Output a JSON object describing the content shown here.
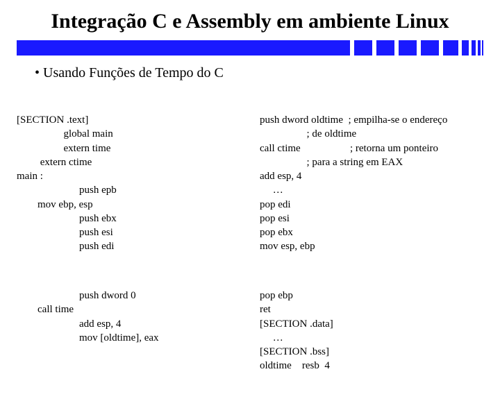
{
  "title": "Integração C e Assembly em ambiente Linux",
  "bullet": "Usando Funções de Tempo do C",
  "left": {
    "block1": "[SECTION .text]\n                  global main\n                  extern time\n         extern ctime\nmain :\n                        push epb\n        mov ebp, esp\n                        push ebx\n                        push esi\n                        push edi",
    "block2": "                        push dword 0\n        call time\n                        add esp, 4\n                        mov [oldtime], eax"
  },
  "right": {
    "block1": "push dword oldtime  ; empilha-se o endereço\n                  ; de oldtime\ncall ctime                   ; retorna um ponteiro\n                  ; para a string em EAX\nadd esp, 4\n     …\npop edi\npop esi\npop ebx\nmov esp, ebp",
    "block2": "pop ebp\nret\n[SECTION .data]\n     …\n[SECTION .bss]\noldtime    resb  4"
  }
}
